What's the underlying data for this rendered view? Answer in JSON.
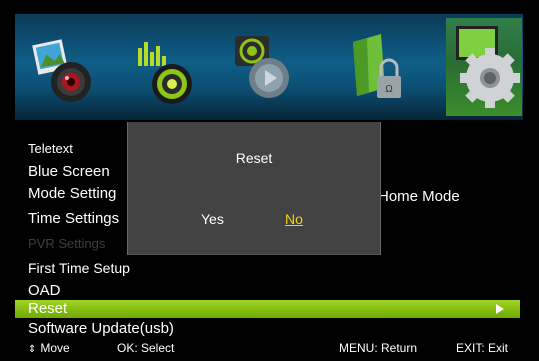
{
  "top_bar": {
    "icons": [
      "picture-icon",
      "sound-icon",
      "channel-icon",
      "lock-icon",
      "setup-gear-icon"
    ],
    "selected_icon": "setup-gear-icon"
  },
  "menu": {
    "items": [
      {
        "label": "Teletext"
      },
      {
        "label": "Blue Screen"
      },
      {
        "label": "Mode Setting"
      },
      {
        "label": "Time Settings"
      },
      {
        "label": "PVR Settings"
      },
      {
        "label": "First Time Setup"
      },
      {
        "label": "OAD"
      },
      {
        "label": "Reset"
      },
      {
        "label": "Software Update(usb)"
      }
    ],
    "mode_value": "Home Mode",
    "highlight_color": "#8cc414"
  },
  "dialog": {
    "title": "Reset",
    "yes_label": "Yes",
    "no_label": "No",
    "focused_color": "#f4d400"
  },
  "help_bar": {
    "move": "Move",
    "select": "OK: Select",
    "return": "MENU: Return",
    "exit": "EXIT: Exit"
  }
}
